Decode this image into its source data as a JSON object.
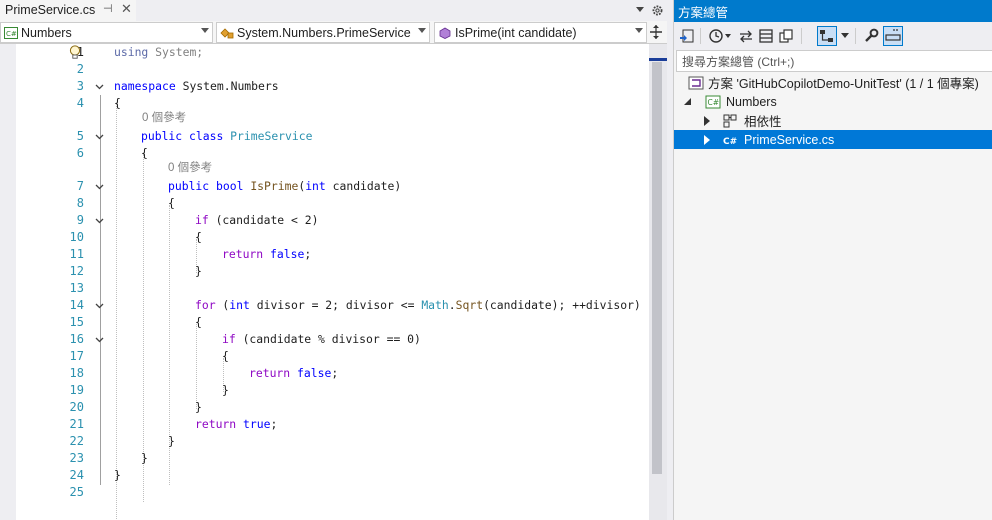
{
  "editor": {
    "tab": {
      "title": "PrimeService.cs",
      "pin_glyph": "⊣",
      "close_glyph": "✕"
    },
    "nav": {
      "project": "Numbers",
      "type": "System.Numbers.PrimeService",
      "member": "IsPrime(int candidate)"
    },
    "lens_text": "0 個參考",
    "line_numbers": [
      "1",
      "2",
      "3",
      "4",
      "5",
      "6",
      "7",
      "8",
      "9",
      "10",
      "11",
      "12",
      "13",
      "14",
      "15",
      "16",
      "17",
      "18",
      "19",
      "20",
      "21",
      "22",
      "23",
      "24",
      "25"
    ],
    "code": {
      "l1_using": "using",
      "l1_rest": " System;",
      "l3_ns": "namespace",
      "l3_rest": " System.Numbers",
      "brace_open": "{",
      "brace_close": "}",
      "l5_public": "public",
      "l5_class": "class",
      "l5_name": "PrimeService",
      "l7_public": "public",
      "l7_bool": "bool",
      "l7_name": "IsPrime",
      "l7_int": "int",
      "l7_rest": " candidate)",
      "l9_if": "if",
      "l9_rest": " (candidate < 2)",
      "l11_return": "return",
      "l11_false": "false",
      "l14_for": "for",
      "l14_int": "int",
      "l14_a": " divisor = 2; divisor <= ",
      "l14_math": "Math",
      "l14_sqrt": "Sqrt",
      "l14_b": "(candidate); ++divisor)",
      "l16_if": "if",
      "l16_rest": " (candidate % divisor == 0)",
      "l18_return": "return",
      "l18_false": "false",
      "l21_return": "return",
      "l21_true": "true"
    }
  },
  "solution_explorer": {
    "title": "方案總管",
    "search_placeholder": "搜尋方案總管 (Ctrl+;)",
    "tree": {
      "solution": "方案 'GitHubCopilotDemo-UnitTest' (1 / 1 個專案)",
      "project": "Numbers",
      "dependencies": "相依性",
      "file": "PrimeService.cs"
    }
  },
  "colors": {
    "accent": "#007acc",
    "selection": "#0078d7",
    "keyword": "#0000ff",
    "type": "#2b91af",
    "method": "#74531f",
    "control": "#8f08c4"
  }
}
